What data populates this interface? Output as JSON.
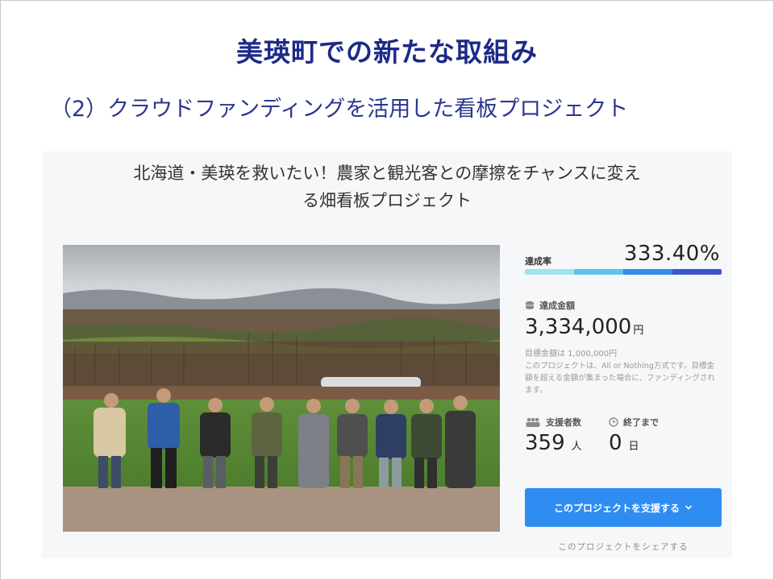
{
  "slide": {
    "title": "美瑛町での新たな取組み",
    "subtitle": "（2）クラウドファンディングを活用した看板プロジェクト"
  },
  "project": {
    "title_line1": "北海道・美瑛を救いたい！農家と観光客との摩擦をチャンスに変え",
    "title_line2": "る畑看板プロジェクト",
    "photo_icon": "farmers-group-photo"
  },
  "stats": {
    "rate_label": "達成率",
    "rate_value": "333.40%",
    "progress_fraction": 1.0,
    "progress_colors": [
      "#9fe3f3",
      "#5ec3ee",
      "#2f8ee6",
      "#3a55cf"
    ],
    "amount_label": "達成金額",
    "amount_icon": "coins-icon",
    "amount_value": "3,334,000",
    "amount_unit": "円",
    "goal_text": "目標金額は 1,000,000円",
    "note": "このプロジェクトは、All or Nothing方式です。目標金額を超える金額が集まった場合に、ファンディングされます。",
    "supporters_label": "支援者数",
    "supporters_icon": "people-icon",
    "supporters_value": "359",
    "supporters_unit": "人",
    "remain_label": "終了まで",
    "remain_icon": "clock-icon",
    "remain_value": "0",
    "remain_unit": "日",
    "support_button": "このプロジェクトを支援する",
    "support_button_icon": "chevron-down-icon",
    "share_link": "このプロジェクトをシェアする",
    "accent_color": "#2f8df2"
  }
}
